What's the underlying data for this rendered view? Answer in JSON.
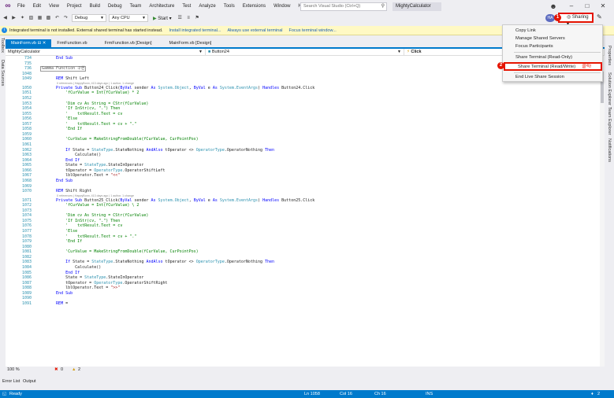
{
  "menubar": {
    "items": [
      "File",
      "Edit",
      "View",
      "Project",
      "Build",
      "Debug",
      "Team",
      "Architecture",
      "Test",
      "Analyze",
      "Tools",
      "Extensions",
      "Window",
      "Help"
    ],
    "search_placeholder": "Search Visual Studio (Ctrl+Q)",
    "solution_name": "MightyCalculator"
  },
  "toolbar": {
    "config": "Debug",
    "platform": "Any CPU",
    "start_label": "Start",
    "avatar_initials": "HA",
    "sharing_label": "Sharing"
  },
  "steps": {
    "one": "1",
    "two": "2"
  },
  "infobar": {
    "message": "Integrated terminal is not installed. External shared terminal has started instead.",
    "link1": "Install integrated terminal...",
    "link2": "Always use external terminal",
    "link3": "Focus terminal window..."
  },
  "side_left": [
    "Toolbox",
    "Data Sources"
  ],
  "side_right": [
    "Properties",
    "Solution Explorer",
    "Team Explorer",
    "Notifications"
  ],
  "doc_tabs": [
    {
      "label": "MainForm.vb"
    },
    {
      "label": "FrmFunction.vb"
    },
    {
      "label": "FrmFunction.vb [Design]"
    },
    {
      "label": "MainForm.vb [Design]"
    }
  ],
  "navbar": {
    "project": "MightyCalculator",
    "object": "Button24",
    "member": "Click"
  },
  "code": [
    {
      "n": "734",
      "t": "    End Sub"
    },
    {
      "n": "735",
      "t": ""
    },
    {
      "n": "736",
      "t": "Gamma Function 구현"
    },
    {
      "n": "1048",
      "t": ""
    },
    {
      "n": "1049",
      "t": "    REM Shift Left"
    },
    {
      "n": "",
      "t": "0 references | HappyBonn, 413 days ago | 1 author, 1 change",
      "lens": true
    },
    {
      "n": "1050",
      "t": "    Private Sub Button24_Click(ByVal sender As System.Object, ByVal e As System.EventArgs) Handles Button24.Click"
    },
    {
      "n": "1051",
      "t": "        'fCurValue = Int(fCurValue) * 2"
    },
    {
      "n": "1052",
      "t": ""
    },
    {
      "n": "1053",
      "t": "        'Dim cv As String = CStr(fCurValue)"
    },
    {
      "n": "1054",
      "t": "        'If InStr(cv, \".\") Then"
    },
    {
      "n": "1055",
      "t": "        '    txtResult.Text = cv"
    },
    {
      "n": "1056",
      "t": "        'Else"
    },
    {
      "n": "1057",
      "t": "        '    txtResult.Text = cv + \".\""
    },
    {
      "n": "1058",
      "t": "        'End If"
    },
    {
      "n": "1059",
      "t": ""
    },
    {
      "n": "1060",
      "t": "        'CurValue = MakeStringFromDouble(fCurValue, CurPointPos)"
    },
    {
      "n": "1061",
      "t": ""
    },
    {
      "n": "1062",
      "t": "        If State = StateType.StateNothing AndAlso tOperator <> OperatorType.OperatorNothing Then"
    },
    {
      "n": "1063",
      "t": "            Calculate()"
    },
    {
      "n": "1064",
      "t": "        End If"
    },
    {
      "n": "1065",
      "t": "        State = StateType.StateInOperator"
    },
    {
      "n": "1066",
      "t": "        tOperator = OperatorType.OperatorShiftLeft"
    },
    {
      "n": "1067",
      "t": "        lblOperator.Text = \"<<\""
    },
    {
      "n": "1068",
      "t": "    End Sub"
    },
    {
      "n": "1069",
      "t": ""
    },
    {
      "n": "1070",
      "t": "    REM Shift Right"
    },
    {
      "n": "",
      "t": "0 references | HappyBonn, 413 days ago | 1 author, 1 change",
      "lens": true
    },
    {
      "n": "1071",
      "t": "    Private Sub Button25_Click(ByVal sender As System.Object, ByVal e As System.EventArgs) Handles Button25.Click"
    },
    {
      "n": "1072",
      "t": "        'fCurValue = Int(fCurValue) \\ 2"
    },
    {
      "n": "1073",
      "t": ""
    },
    {
      "n": "1074",
      "t": "        'Dim cv As String = CStr(fCurValue)"
    },
    {
      "n": "1075",
      "t": "        'If InStr(cv, \".\") Then"
    },
    {
      "n": "1076",
      "t": "        '    txtResult.Text = cv"
    },
    {
      "n": "1077",
      "t": "        'Else"
    },
    {
      "n": "1078",
      "t": "        '    txtResult.Text = cv + \".\""
    },
    {
      "n": "1079",
      "t": "        'End If"
    },
    {
      "n": "1080",
      "t": ""
    },
    {
      "n": "1081",
      "t": "        'CurValue = MakeStringFromDouble(fCurValue, CurPointPos)"
    },
    {
      "n": "1082",
      "t": ""
    },
    {
      "n": "1083",
      "t": "        If State = StateType.StateNothing AndAlso tOperator <> OperatorType.OperatorNothing Then"
    },
    {
      "n": "1084",
      "t": "            Calculate()"
    },
    {
      "n": "1085",
      "t": "        End If"
    },
    {
      "n": "1086",
      "t": "        State = StateType.StateInOperator"
    },
    {
      "n": "1087",
      "t": "        tOperator = OperatorType.OperatorShiftRight"
    },
    {
      "n": "1088",
      "t": "        lblOperator.Text = \">>\""
    },
    {
      "n": "1089",
      "t": "    End Sub"
    },
    {
      "n": "1090",
      "t": ""
    },
    {
      "n": "1091",
      "t": "    REM ="
    }
  ],
  "editor_status": {
    "zoom": "100 %",
    "errors": "0",
    "warnings": "2"
  },
  "bottom_tabs": [
    "Error List",
    "Output"
  ],
  "statusbar": {
    "ready": "Ready",
    "ln": "Ln 1058",
    "col": "Col 16",
    "ch": "Ch 16",
    "ins": "INS",
    "notif_count": "2"
  },
  "share_menu": {
    "items": [
      "Copy Link",
      "Manage Shared Servers",
      "Focus Participants",
      "Share Terminal (Read-Only)",
      "Share Terminal (Read/Write)",
      "End Live Share Session"
    ],
    "click_tag": "클릭!"
  },
  "colors": {
    "accent": "#007acc",
    "highlight": "#e51400",
    "keyword": "#0000ff",
    "type": "#2b91af",
    "comment": "#008000",
    "string": "#a31515"
  }
}
